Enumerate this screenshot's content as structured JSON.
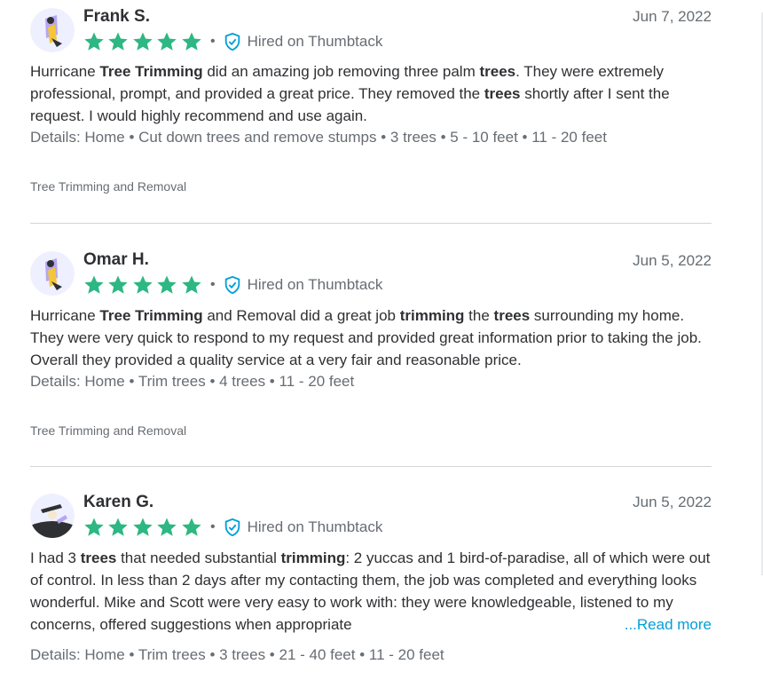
{
  "reviews": [
    {
      "name": "Frank S.",
      "date": "Jun 7, 2022",
      "rating": 5,
      "hired_label": "Hired on Thumbtack",
      "body_segments": [
        {
          "t": "Hurricane ",
          "b": false
        },
        {
          "t": "Tree Trimming",
          "b": true
        },
        {
          "t": " did an amazing job removing three palm ",
          "b": false
        },
        {
          "t": "trees",
          "b": true
        },
        {
          "t": ". They were extremely professional, prompt, and provided a great price. They removed the ",
          "b": false
        },
        {
          "t": "trees",
          "b": true
        },
        {
          "t": " shortly after I sent the request. I would highly recommend and use again.",
          "b": false
        }
      ],
      "details": "Details: Home • Cut down trees and remove stumps • 3 trees • 5 - 10 feet • 11 - 20 feet",
      "tag": "Tree Trimming and Removal",
      "avatar": "avatar-yellow"
    },
    {
      "name": "Omar H.",
      "date": "Jun 5, 2022",
      "rating": 5,
      "hired_label": "Hired on Thumbtack",
      "body_segments": [
        {
          "t": "Hurricane ",
          "b": false
        },
        {
          "t": "Tree Trimming",
          "b": true
        },
        {
          "t": " and Removal did a great job ",
          "b": false
        },
        {
          "t": "trimming",
          "b": true
        },
        {
          "t": " the ",
          "b": false
        },
        {
          "t": "trees",
          "b": true
        },
        {
          "t": " surrounding my home. They were very quick to respond to my request and provided great information prior to taking the job. Overall they provided a quality service at a very fair and reasonable price.",
          "b": false
        }
      ],
      "details": "Details: Home • Trim trees • 4 trees • 11 - 20 feet",
      "tag": "Tree Trimming and Removal",
      "avatar": "avatar-yellow"
    },
    {
      "name": "Karen G.",
      "date": "Jun 5, 2022",
      "rating": 5,
      "hired_label": "Hired on Thumbtack",
      "body_segments": [
        {
          "t": "I had 3 ",
          "b": false
        },
        {
          "t": "trees",
          "b": true
        },
        {
          "t": " that needed substantial ",
          "b": false
        },
        {
          "t": "trimming",
          "b": true
        },
        {
          "t": ": 2 yuccas and 1 bird-of-paradise, all of which were out of control. In less than 2 days after my contacting them, the job was completed and everything looks wonderful. Mike and Scott were very easy to work with: they were knowledgeable, listened to my concerns, offered suggestions when appropriate",
          "b": false
        }
      ],
      "read_more": "...Read more",
      "details": "Details: Home • Trim trees • 3 trees • 21 - 40 feet • 11 - 20 feet",
      "avatar": "avatar-dark"
    }
  ],
  "colors": {
    "star": "#2db783",
    "hired_icon": "#009fd9",
    "link": "#009fd9",
    "muted": "#676d73",
    "text": "#2f3033"
  }
}
